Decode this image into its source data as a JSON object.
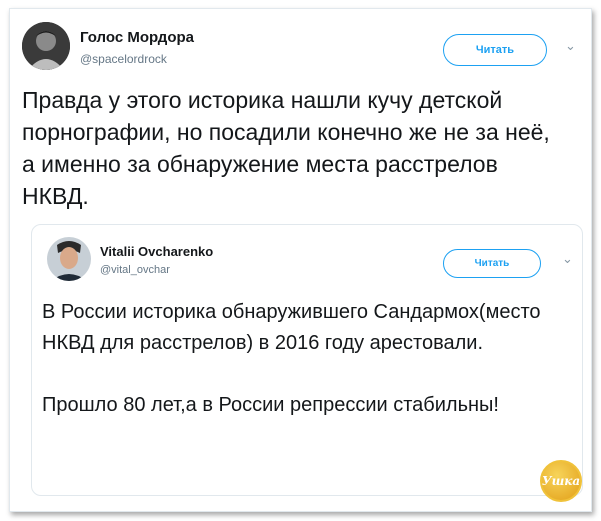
{
  "tweet": {
    "author_name": "Голос Мордора",
    "author_handle": "@spacelordrock",
    "follow_label": "Читать",
    "text": "Правда у этого историка нашли кучу детской порнографии, но посадили конечно же не за неё, а именно за обнаружение места расстрелов НКВД."
  },
  "quoted_tweet": {
    "author_name": "Vitalii Ovcharenko",
    "author_handle": "@vital_ovchar",
    "follow_label": "Читать",
    "paragraph_1": "В России историка обнаружившего Сандармох(место НКВД для расстрелов) в 2016 году арестовали.",
    "paragraph_2": "Прошло 80 лет,а в России репрессии стабильны!"
  },
  "watermark": {
    "text": "Ушка"
  },
  "icons": {
    "more": "chevron-down-icon"
  },
  "colors": {
    "accent": "#1da1f2",
    "secondary_text": "#657786",
    "border": "#e1e8ed"
  }
}
